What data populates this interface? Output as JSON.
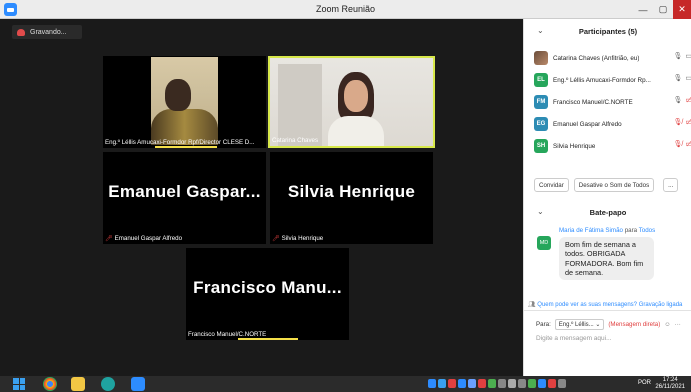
{
  "window": {
    "title": "Zoom Reunião",
    "minimize": "—",
    "maximize": "▢",
    "close": "✕"
  },
  "recording": {
    "label": "Gravando..."
  },
  "tiles": [
    {
      "name": "Eng.º Léllis Amucaxi-Formdor Rpf/Director CLESE D...",
      "has_video": true,
      "muted": false
    },
    {
      "name": "Catarina Chaves",
      "has_video": true,
      "muted": false,
      "active_speaker": true
    },
    {
      "big_name": "Emanuel Gaspar...",
      "name": "Emanuel Gaspar Alfredo",
      "muted": true
    },
    {
      "big_name": "Silvia Henrique",
      "name": "Silvia Henrique",
      "muted": true
    },
    {
      "big_name": "Francisco Manu...",
      "name": "Francisco Manuel/C.NORTE",
      "muted": false
    }
  ],
  "participants": {
    "header": "Participantes (5)",
    "items": [
      {
        "initials": "",
        "name": "Catarina Chaves (Anfitrião, eu)",
        "avatar": "photo",
        "mic": "on",
        "video": "on"
      },
      {
        "initials": "EL",
        "name": "Eng.º Léllis Amucaxi-Formdor Rp...",
        "avatar": "green",
        "mic": "on",
        "video": "on"
      },
      {
        "initials": "FM",
        "name": "Francisco Manuel/C.NORTE",
        "avatar": "teal",
        "mic": "on",
        "video": "off"
      },
      {
        "initials": "EG",
        "name": "Emanuel Gaspar Alfredo",
        "avatar": "teal",
        "mic": "muted",
        "video": "off"
      },
      {
        "initials": "SH",
        "name": "Silvia Henrique",
        "avatar": "green",
        "mic": "muted",
        "video": "off"
      }
    ],
    "buttons": {
      "invite": "Convidar",
      "unmute_all": "Desative o Som de Todos",
      "more": "..."
    }
  },
  "chat": {
    "header": "Bate-papo",
    "sender": "Maria de Fátima Simão",
    "to_word": "para",
    "recipient": "Todos",
    "sender_initials": "MD",
    "message": "Bom fim de semana a todos. OBRIGADA FORMADORA. Bom fim de semana.",
    "privacy_link": "Quem pode ver as suas mensagens? Gravação ligada",
    "to_label": "Para:",
    "to_select": "Eng.º Léllis...",
    "direct": "(Mensagem direta)",
    "input_placeholder": "Digite a mensagem aqui..."
  },
  "taskbar": {
    "lang": "POR",
    "time": "17:24",
    "date": "26/11/2021"
  },
  "colors": {
    "accent": "#2d8cff",
    "speaker_highlight": "#f5e04a",
    "muted_red": "#e04040",
    "avatar_green": "#26a65b"
  }
}
